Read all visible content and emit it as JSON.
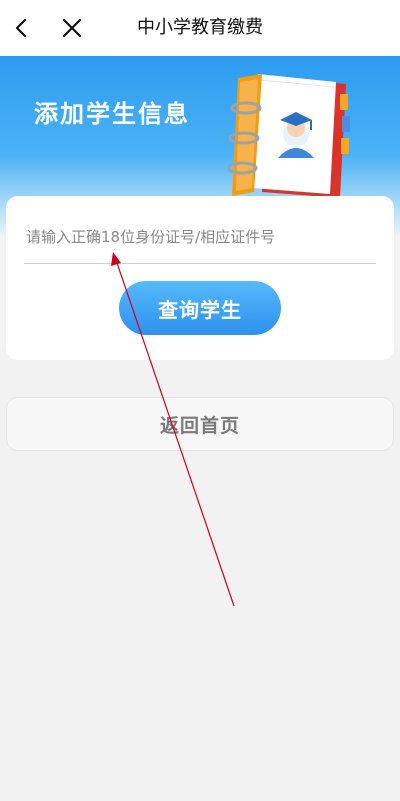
{
  "header": {
    "title": "中小学教育缴费",
    "back_icon": "chevron-left-icon",
    "close_icon": "close-icon"
  },
  "banner": {
    "title": "添加学生信息",
    "illustration": "student-notebook-icon"
  },
  "form": {
    "id_placeholder": "请输入正确18位身份证号/相应证件号",
    "id_value": "",
    "query_button": "查询学生"
  },
  "footer": {
    "home_button": "返回首页"
  },
  "colors": {
    "accent": "#2e91ee",
    "banner_top": "#2d9bf0",
    "annotation_arrow": "#d0021b"
  }
}
